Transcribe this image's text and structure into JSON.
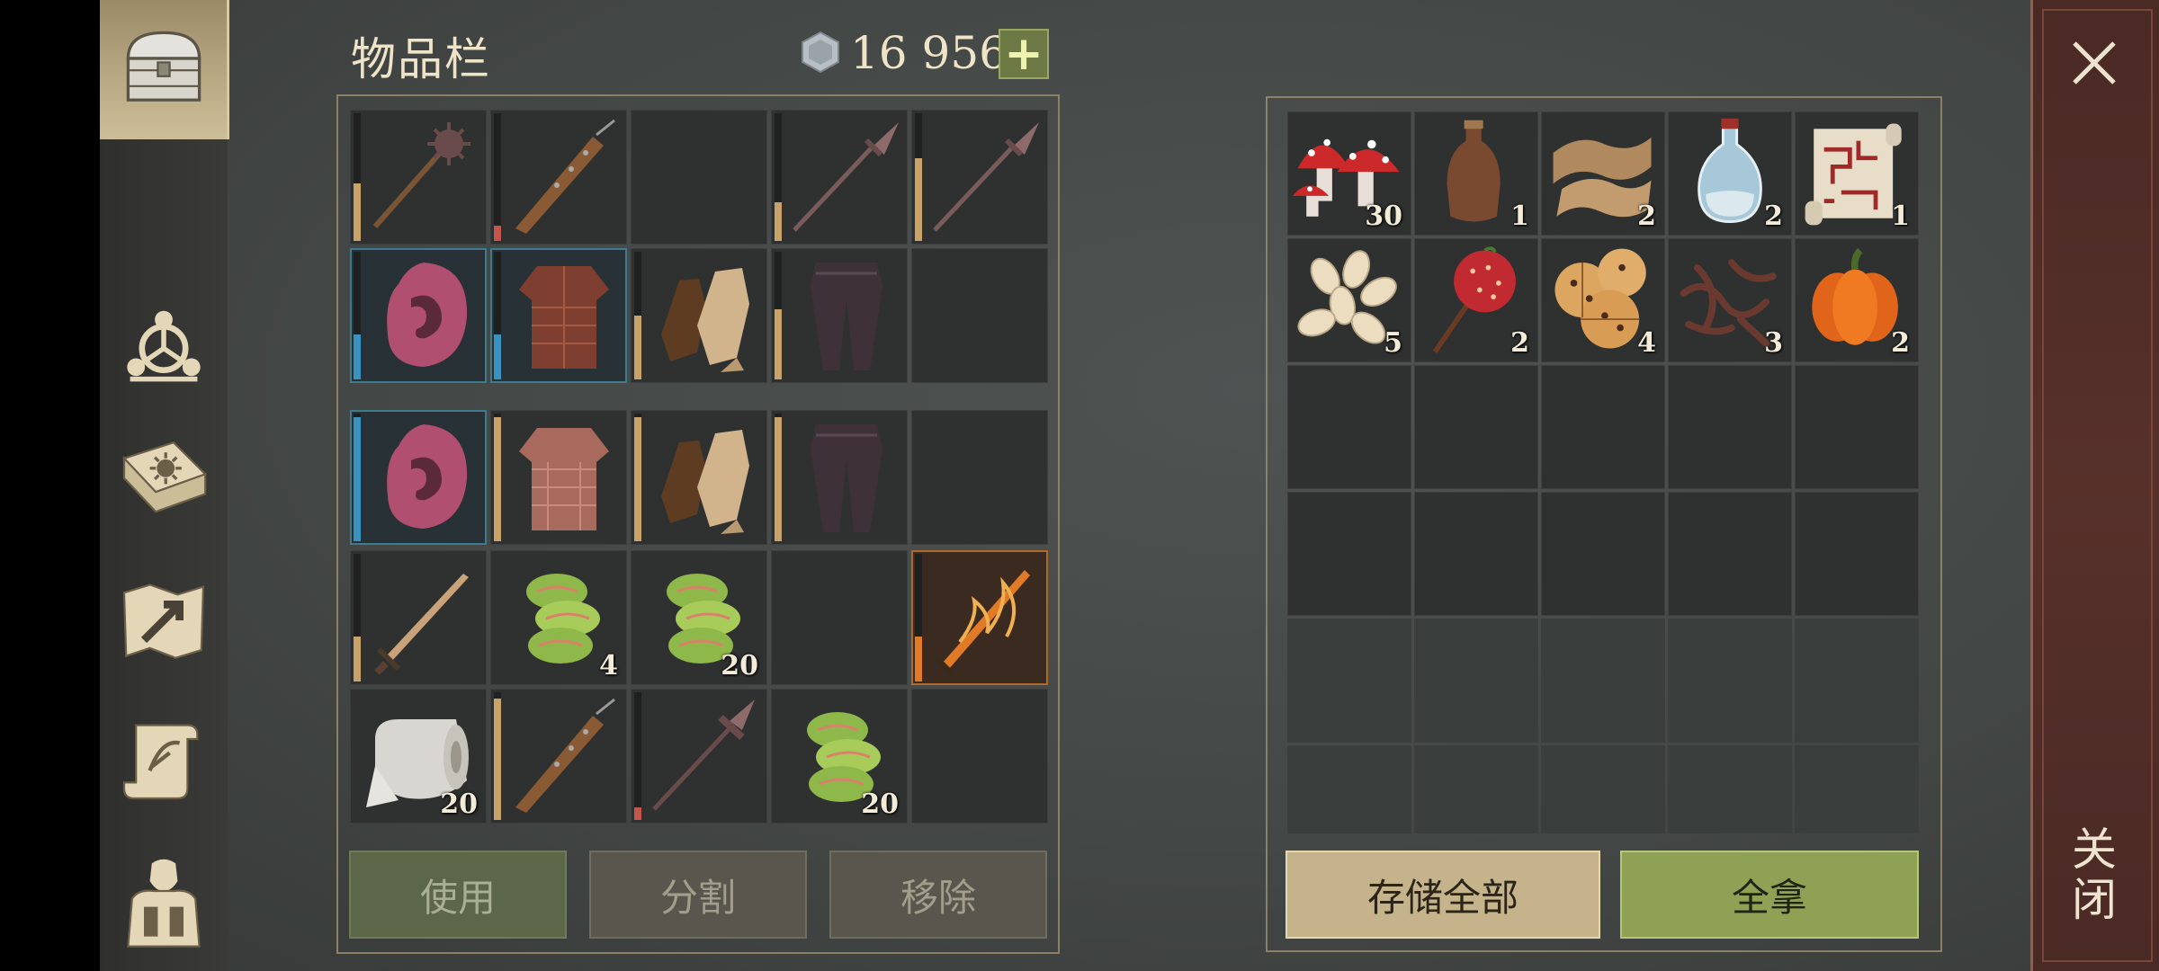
{
  "header": {
    "title": "物品栏",
    "currency": "16  956",
    "add_label": "+"
  },
  "sidebar": {
    "icons": [
      "chest-icon",
      "crafting-icon",
      "skills-book-icon",
      "map-icon",
      "quests-scroll-icon",
      "character-icon"
    ]
  },
  "inventory": {
    "slots": [
      {
        "icon": "spiked-mace",
        "dur": 0.45,
        "dur_color": "#c9a36a"
      },
      {
        "icon": "spiked-club",
        "dur": 0.12,
        "dur_color": "#c4554a"
      },
      {
        "icon": "",
        "dur": 0
      },
      {
        "icon": "spear",
        "dur": 0.3,
        "dur_color": "#c9a36a"
      },
      {
        "icon": "spear",
        "dur": 0.65,
        "dur_color": "#c9a36a"
      },
      {
        "icon": "hood",
        "dur": 0.35,
        "dur_color": "#3a92c0",
        "style": "blue"
      },
      {
        "icon": "chainmail-tunic",
        "dur": 0.35,
        "dur_color": "#3a92c0",
        "style": "blue"
      },
      {
        "icon": "leather-gloves",
        "dur": 0.5,
        "dur_color": "#c9a36a"
      },
      {
        "icon": "pants",
        "dur": 0.55,
        "dur_color": "#c9a36a"
      },
      {
        "icon": "",
        "dur": 0
      },
      {
        "icon": "hood",
        "dur": 0.97,
        "dur_color": "#3a92c0",
        "style": "blue"
      },
      {
        "icon": "padded-tunic",
        "dur": 0.97,
        "dur_color": "#c9a36a"
      },
      {
        "icon": "leather-gloves",
        "dur": 0.97,
        "dur_color": "#c9a36a"
      },
      {
        "icon": "pants",
        "dur": 0.97,
        "dur_color": "#c9a36a"
      },
      {
        "icon": "",
        "dur": 0
      },
      {
        "icon": "sword",
        "dur": 0.35,
        "dur_color": "#c9a36a"
      },
      {
        "icon": "fiber-bundle",
        "count": "4",
        "dur": 0
      },
      {
        "icon": "fiber-bundle",
        "count": "20",
        "dur": 0
      },
      {
        "icon": "",
        "dur": 0
      },
      {
        "icon": "fire-sword",
        "dur": 0.35,
        "dur_color": "#e07a26",
        "style": "fire"
      },
      {
        "icon": "cloth-roll",
        "count": "20",
        "dur": 0
      },
      {
        "icon": "spiked-club",
        "dur": 0.95,
        "dur_color": "#c9a36a"
      },
      {
        "icon": "mace",
        "dur": 0.1,
        "dur_color": "#c4554a"
      },
      {
        "icon": "fiber-bundle",
        "count": "20",
        "dur": 0
      },
      {
        "icon": "",
        "dur": 0
      }
    ],
    "buttons": {
      "use": "使用",
      "split": "分割",
      "remove": "移除"
    }
  },
  "container": {
    "slots": [
      {
        "icon": "mushrooms",
        "count": "30"
      },
      {
        "icon": "leather-flask",
        "count": "1"
      },
      {
        "icon": "burlap-cloth",
        "count": "2"
      },
      {
        "icon": "water-bottle",
        "count": "2"
      },
      {
        "icon": "treasure-map",
        "count": "1",
        "style": "sel"
      },
      {
        "icon": "seeds",
        "count": "5"
      },
      {
        "icon": "candied-apple",
        "count": "2"
      },
      {
        "icon": "cookies",
        "count": "4"
      },
      {
        "icon": "jerky",
        "count": "3"
      },
      {
        "icon": "pumpkin",
        "count": "2"
      }
    ],
    "buttons": {
      "store_all": "存储全部",
      "take_all": "全拿"
    }
  },
  "close": {
    "label": "关闭"
  }
}
